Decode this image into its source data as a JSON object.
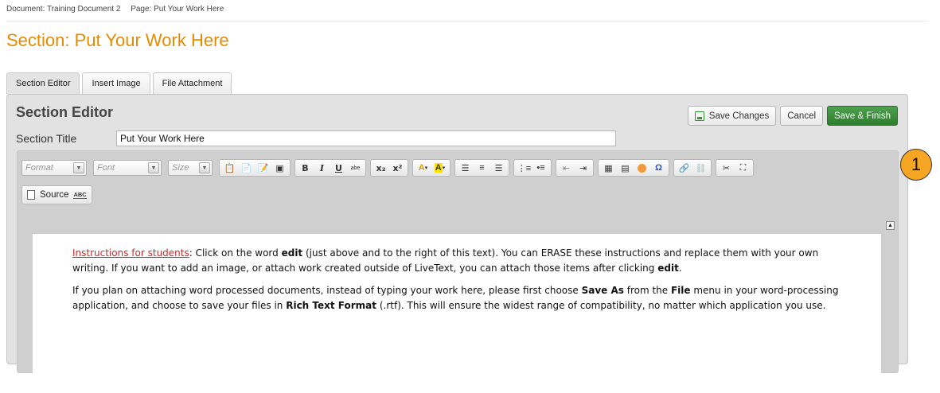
{
  "breadcrumb": {
    "document": "Document: Training Document 2",
    "page": "Page: Put Your Work Here"
  },
  "page_title": "Section: Put Your Work Here",
  "tabs": [
    {
      "label": "Section Editor",
      "active": true
    },
    {
      "label": "Insert Image",
      "active": false
    },
    {
      "label": "File Attachment",
      "active": false
    }
  ],
  "editor": {
    "heading": "Section Editor",
    "save_changes_label": "Save Changes",
    "cancel_label": "Cancel",
    "save_finish_label": "Save & Finish",
    "section_title_label": "Section Title",
    "section_title_value": "Put Your Work Here"
  },
  "toolbar": {
    "format_label": "Format",
    "font_label": "Font",
    "size_label": "Size",
    "bold": "B",
    "italic": "I",
    "underline": "U",
    "strike": "abe",
    "source_label": "Source",
    "spellcheck_label": "ABC"
  },
  "content": {
    "p1_link": "Instructions for students",
    "p1_a": ": Click on the word ",
    "p1_b1": "edit",
    "p1_c": " (just above and to the right of this text). You can ERASE these instructions and replace them with your own writing. If you want to add an image, or attach work created outside of LiveText, you can attach those items after clicking ",
    "p1_b2": "edit",
    "p1_d": ".",
    "p2_a": "If you plan on attaching word processed documents, instead of typing your work here, please first choose ",
    "p2_b1": "Save As",
    "p2_c": " from the ",
    "p2_b2": "File",
    "p2_d": " menu in your word-processing application, and choose to save your files in ",
    "p2_b3": "Rich Text Format",
    "p2_e": " (.rtf). This will ensure the widest range of compatibility, no matter which application you use."
  },
  "callout_number": "1",
  "colors": {
    "title": "#e68a00",
    "save_finish": "#3a8f3a",
    "callout": "#f7a623",
    "link": "#d42525"
  }
}
